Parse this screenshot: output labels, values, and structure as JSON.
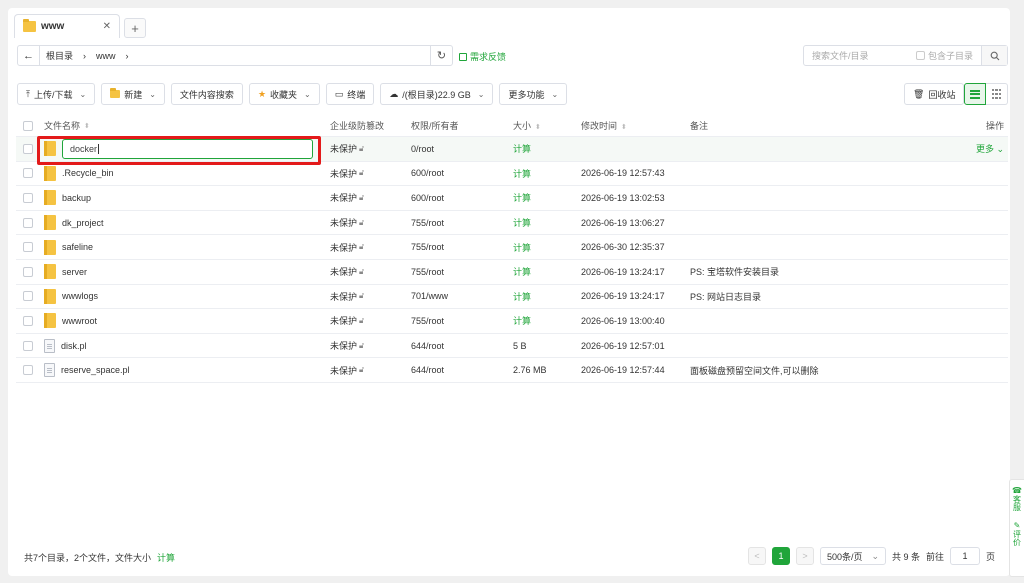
{
  "tabs": [
    {
      "label": "www",
      "close": "✕"
    }
  ],
  "tab_add": "+",
  "address": {
    "back": "←",
    "crumbs": [
      "根目录",
      "www"
    ],
    "refresh": "↻"
  },
  "feedback": "需求反馈",
  "search": {
    "placeholder": "搜索文件/目录",
    "subdir_label": "包含子目录"
  },
  "toolbar": {
    "upload": "上传/下载",
    "new": "新建",
    "content_search": "文件内容搜索",
    "favorites": "收藏夹",
    "terminal": "终端",
    "disk": "/(根目录)22.9 GB",
    "more": "更多功能",
    "recycle": "回收站"
  },
  "table": {
    "headers": {
      "name": "文件名称",
      "protect": "企业级防篡改",
      "perm": "权限/所有者",
      "size": "大小",
      "mtime": "修改时间",
      "note": "备注",
      "op": "操作"
    },
    "rename_value": "docker",
    "rename_row": {
      "protect": "未保护",
      "perm": "0/root",
      "size": "计算",
      "op": "更多"
    },
    "rows": [
      {
        "name": ".Recycle_bin",
        "type": "folder",
        "protect": "未保护",
        "perm": "600/root",
        "size": "计算",
        "mtime": "2026-06-19 12:57:43",
        "note": ""
      },
      {
        "name": "backup",
        "type": "folder",
        "protect": "未保护",
        "perm": "600/root",
        "size": "计算",
        "mtime": "2026-06-19 13:02:53",
        "note": ""
      },
      {
        "name": "dk_project",
        "type": "folder",
        "protect": "未保护",
        "perm": "755/root",
        "size": "计算",
        "mtime": "2026-06-19 13:06:27",
        "note": ""
      },
      {
        "name": "safeline",
        "type": "folder",
        "protect": "未保护",
        "perm": "755/root",
        "size": "计算",
        "mtime": "2026-06-30 12:35:37",
        "note": ""
      },
      {
        "name": "server",
        "type": "folder",
        "protect": "未保护",
        "perm": "755/root",
        "size": "计算",
        "mtime": "2026-06-19 13:24:17",
        "note": "PS: 宝塔软件安装目录"
      },
      {
        "name": "wwwlogs",
        "type": "folder",
        "protect": "未保护",
        "perm": "701/www",
        "size": "计算",
        "mtime": "2026-06-19 13:24:17",
        "note": "PS: 网站日志目录"
      },
      {
        "name": "wwwroot",
        "type": "folder",
        "protect": "未保护",
        "perm": "755/root",
        "size": "计算",
        "mtime": "2026-06-19 13:00:40",
        "note": ""
      },
      {
        "name": "disk.pl",
        "type": "file",
        "protect": "未保护",
        "perm": "644/root",
        "size": "5 B",
        "mtime": "2026-06-19 12:57:01",
        "note": ""
      },
      {
        "name": "reserve_space.pl",
        "type": "file",
        "protect": "未保护",
        "perm": "644/root",
        "size": "2.76 MB",
        "mtime": "2026-06-19 12:57:44",
        "note": "面板磁盘预留空间文件,可以删除"
      }
    ]
  },
  "footer": {
    "summary": "共7个目录，2个文件，文件大小",
    "calc": "计算"
  },
  "pager": {
    "prev": "<",
    "current": "1",
    "next": ">",
    "per_page": "500条/页",
    "total": "共 9 条",
    "goto": "前往",
    "page_value": "1",
    "page_unit": "页"
  },
  "side": {
    "service": "客服",
    "rate": "评价"
  },
  "colors": {
    "accent": "#20a53a",
    "highlight": "#e31a1a"
  }
}
